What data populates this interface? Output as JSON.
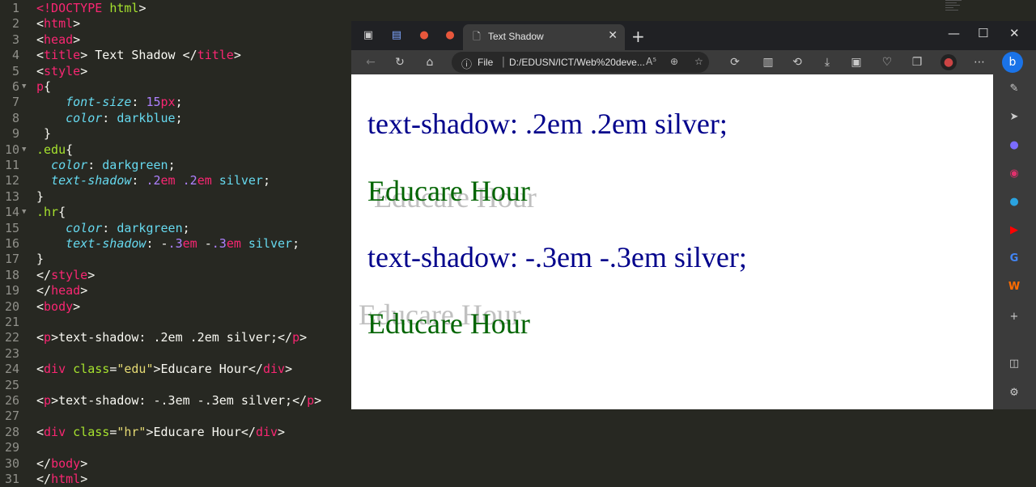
{
  "editor": {
    "lines": [
      {
        "n": "1",
        "html": "<span class='t'>&lt;!DOCTYPE</span> <span class='a'>html</span>&gt;"
      },
      {
        "n": "2",
        "html": "&lt;<span class='t'>html</span>&gt;"
      },
      {
        "n": "3",
        "html": "&lt;<span class='t'>head</span>&gt;"
      },
      {
        "n": "4",
        "html": "&lt;<span class='t'>title</span>&gt; Text Shadow &lt;/<span class='t'>title</span>&gt;"
      },
      {
        "n": "5",
        "html": "&lt;<span class='t'>style</span>&gt;"
      },
      {
        "n": "6",
        "fold": true,
        "html": "<span class='t'>p</span>{"
      },
      {
        "n": "7",
        "html": "    <span class='k'>font-size</span>: <span class='n'>15</span><span class='u'>px</span>;"
      },
      {
        "n": "8",
        "html": "    <span class='k'>color</span>: <span class='v'>darkblue</span>;"
      },
      {
        "n": "9",
        "html": " }"
      },
      {
        "n": "10",
        "fold": true,
        "html": "<span class='sel'>.edu</span>{"
      },
      {
        "n": "11",
        "html": "  <span class='k'>color</span>: <span class='v'>darkgreen</span>;"
      },
      {
        "n": "12",
        "html": "  <span class='k'>text-shadow</span>: <span class='n'>.2</span><span class='u'>em</span> <span class='n'>.2</span><span class='u'>em</span> <span class='v'>silver</span>;"
      },
      {
        "n": "13",
        "html": "}"
      },
      {
        "n": "14",
        "fold": true,
        "html": "<span class='sel'>.hr</span>{"
      },
      {
        "n": "15",
        "html": "    <span class='k'>color</span>: <span class='v'>darkgreen</span>;"
      },
      {
        "n": "16",
        "html": "    <span class='k'>text-shadow</span>: -<span class='n'>.3</span><span class='u'>em</span> -<span class='n'>.3</span><span class='u'>em</span> <span class='v'>silver</span>;"
      },
      {
        "n": "17",
        "html": "}"
      },
      {
        "n": "18",
        "html": "&lt;/<span class='t'>style</span>&gt;"
      },
      {
        "n": "19",
        "html": "&lt;/<span class='t'>head</span>&gt;"
      },
      {
        "n": "20",
        "html": "&lt;<span class='t'>body</span>&gt;"
      },
      {
        "n": "21",
        "html": ""
      },
      {
        "n": "22",
        "html": "&lt;<span class='t'>p</span>&gt;text-shadow: .2em .2em silver;&lt;/<span class='t'>p</span>&gt;"
      },
      {
        "n": "23",
        "html": ""
      },
      {
        "n": "24",
        "html": "&lt;<span class='t'>div</span> <span class='a'>class</span>=<span class='s'>\"edu\"</span>&gt;Educare Hour&lt;/<span class='t'>div</span>&gt;"
      },
      {
        "n": "25",
        "html": ""
      },
      {
        "n": "26",
        "html": "&lt;<span class='t'>p</span>&gt;text-shadow: -.3em -.3em silver;&lt;/<span class='t'>p</span>&gt;"
      },
      {
        "n": "27",
        "html": ""
      },
      {
        "n": "28",
        "html": "&lt;<span class='t'>div</span> <span class='a'>class</span>=<span class='s'>\"hr\"</span>&gt;Educare Hour&lt;/<span class='t'>div</span>&gt;"
      },
      {
        "n": "29",
        "html": ""
      },
      {
        "n": "30",
        "html": "&lt;/<span class='t'>body</span>&gt;"
      },
      {
        "n": "31",
        "html": "&lt;/<span class='t'>html</span>&gt;"
      }
    ]
  },
  "browser": {
    "tab_title": "Text Shadow",
    "tab_close": "✕",
    "new_tab": "+",
    "address_info_icon": "ⓘ",
    "address_scheme": "File",
    "address_sep": "|",
    "address_url": "D:/EDUSN/ICT/Web%20deve...",
    "address_read_aloud": "A⁵",
    "window": {
      "minimize": "—",
      "maximize": "☐",
      "close": "✕"
    },
    "page": {
      "p1": "text-shadow: .2em .2em silver;",
      "edu": "Educare Hour",
      "p2": "text-shadow: -.3em -.3em silver;",
      "hr": "Educare Hour"
    }
  },
  "colors": {
    "editor_bg": "#272822",
    "browser_chrome": "#3b3b3b",
    "title_bar": "#202124",
    "darkblue": "#00008b",
    "darkgreen": "#006400",
    "silver": "#c0c0c0"
  }
}
